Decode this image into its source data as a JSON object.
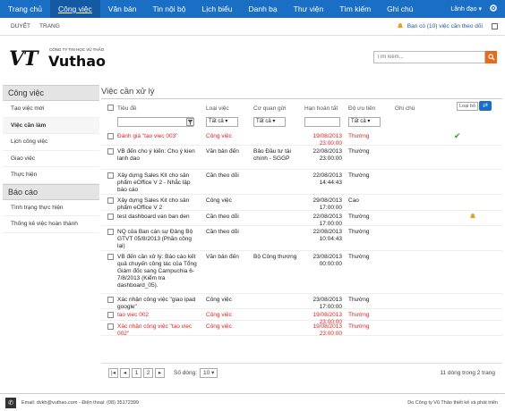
{
  "topnav": {
    "items": [
      "Trang chủ",
      "Công việc",
      "Văn bản",
      "Tin nội bộ",
      "Lịch biểu",
      "Danh bạ",
      "Thư viện",
      "Tìm kiếm",
      "Ghi chú"
    ],
    "user": "Lãnh đạo"
  },
  "subbar": {
    "items": [
      "DUYỆT",
      "TRANG"
    ],
    "notice": "Bạn có (10) việc cần theo dõi"
  },
  "brand": {
    "logo": "VT",
    "company": "CÔNG TY TIN HỌC VŨ THẢO",
    "name": "Vuthao"
  },
  "search": {
    "placeholder": "Tìm kiếm..."
  },
  "sidebar": {
    "group1": "Công việc",
    "items1": [
      "Tạo việc mới",
      "Việc cần làm",
      "Lịch công việc",
      "Giao việc",
      "Thực hiện"
    ],
    "group2": "Báo cáo",
    "items2": [
      "Tình trạng thực hiện",
      "Thống kê việc hoàn thành"
    ]
  },
  "main": {
    "title": "Việc cần xử lý",
    "columns": [
      "Tiêu đề",
      "Loại việc",
      "Cơ quan gửi",
      "Hạn hoàn tất",
      "Độ ưu tiên",
      "Ghi chú"
    ],
    "filter_all": "Tất cả",
    "reset_label": "Loại bỏ",
    "rows": [
      {
        "title": "Đánh giá \"tạo viec 003\"",
        "type": "Công việc",
        "org": "",
        "due": "19/08/2013 23:00:00",
        "prio": "Thường",
        "red": true,
        "mark": "check"
      },
      {
        "title": "VB đến cho ý kiến: Cho ý kien lanh dao",
        "type": "Văn bản đến",
        "org": "Bảo Đầu tư tài chính - SGGP",
        "due": "22/08/2013 23:00:00",
        "prio": "Thường",
        "red": false,
        "mark": ""
      },
      {
        "title": "Xây dựng Sales Kit cho sản phẩm eOffice V 2 - Nhắc lập báo cáo",
        "type": "Cần theo dõi",
        "org": "",
        "due": "22/08/2013 14:44:43",
        "prio": "Thường",
        "red": false,
        "mark": ""
      },
      {
        "title": "Xây dựng Sales Kit cho sản phẩm eOffice V 2",
        "type": "Công việc",
        "org": "",
        "due": "29/08/2013 17:00:00",
        "prio": "Cao",
        "red": false,
        "mark": ""
      },
      {
        "title": "test dashboard van ban den",
        "type": "Cần theo dõi",
        "org": "",
        "due": "22/08/2013 17:00:00",
        "prio": "Thường",
        "red": false,
        "mark": "bell"
      },
      {
        "title": "NQ của Ban cán sự Đảng Bộ GTVT 05/8/2013 (Phần công lại)",
        "type": "Cần theo dõi",
        "org": "",
        "due": "22/08/2013 10:04:43",
        "prio": "Thường",
        "red": false,
        "mark": ""
      },
      {
        "title": "VB đến cần xử lý: Báo cáo kết quả chuyến công tác của Tổng Giám đốc sang Campuchia 6-7/8/2013 (Kiểm tra dashboard_05).",
        "type": "Văn bản đến",
        "org": "Bộ Công thương",
        "due": "23/08/2013 00:00:00",
        "prio": "Thường",
        "red": false,
        "mark": ""
      },
      {
        "title": "Xác nhận công việc \"giao ipad google\"",
        "type": "Công việc",
        "org": "",
        "due": "23/08/2013 17:00:00",
        "prio": "Thường",
        "red": false,
        "mark": ""
      },
      {
        "title": "tao viec 002",
        "type": "Công việc",
        "org": "",
        "due": "19/08/2013 23:00:00",
        "prio": "Thường",
        "red": true,
        "mark": ""
      },
      {
        "title": "Xác nhận công việc \"tao viec 002\"",
        "type": "Công việc",
        "org": "",
        "due": "19/08/2013 23:00:00",
        "prio": "Thường",
        "red": true,
        "mark": ""
      }
    ]
  },
  "pager": {
    "p1": "1",
    "p2": "2",
    "rows_label": "Số dòng:",
    "rows_value": "10",
    "summary": "11 dòng trong 2 trang"
  },
  "footer": {
    "contact": "Email: dvkh@vuthao.com - Điện thoại: (08) 35172399",
    "credit": "Do Công ty Vũ Thảo thiết kế và phát triển"
  }
}
